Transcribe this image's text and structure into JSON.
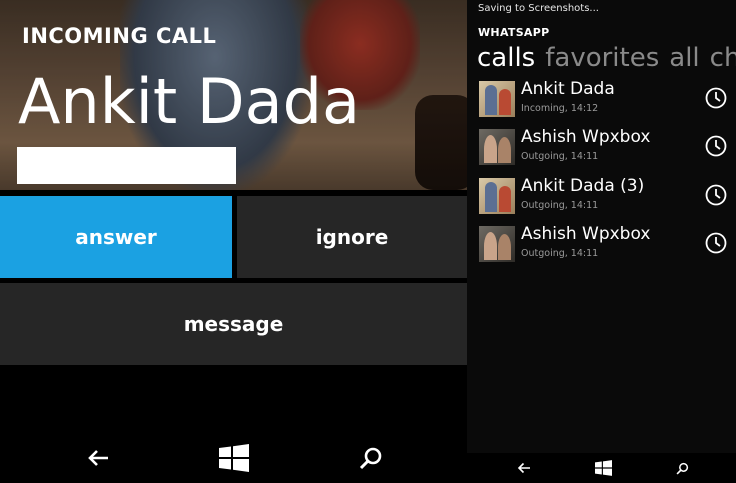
{
  "call": {
    "heading": "INCOMING CALL",
    "caller_name": "Ankit Dada",
    "actions": {
      "answer": "answer",
      "ignore": "ignore",
      "message": "message"
    }
  },
  "colors": {
    "accent": "#1ba1e2",
    "tile": "#262626",
    "background": "#000000"
  },
  "nav": {
    "back_icon": "back-arrow-icon",
    "home_icon": "windows-logo-icon",
    "search_icon": "search-icon"
  },
  "whatsapp": {
    "status_text": "Saving to Screenshots...",
    "app_title": "WHATSAPP",
    "pivots": [
      "calls",
      "favorites",
      "all",
      "cha"
    ],
    "calls": [
      {
        "name": "Ankit Dada",
        "detail": "Incoming, 14:12",
        "avatar": "a"
      },
      {
        "name": "Ashish Wpxbox",
        "detail": "Outgoing, 14:11",
        "avatar": "b"
      },
      {
        "name": "Ankit Dada (3)",
        "detail": "Outgoing, 14:11",
        "avatar": "a"
      },
      {
        "name": "Ashish Wpxbox",
        "detail": "Outgoing, 14:11",
        "avatar": "b"
      }
    ]
  }
}
